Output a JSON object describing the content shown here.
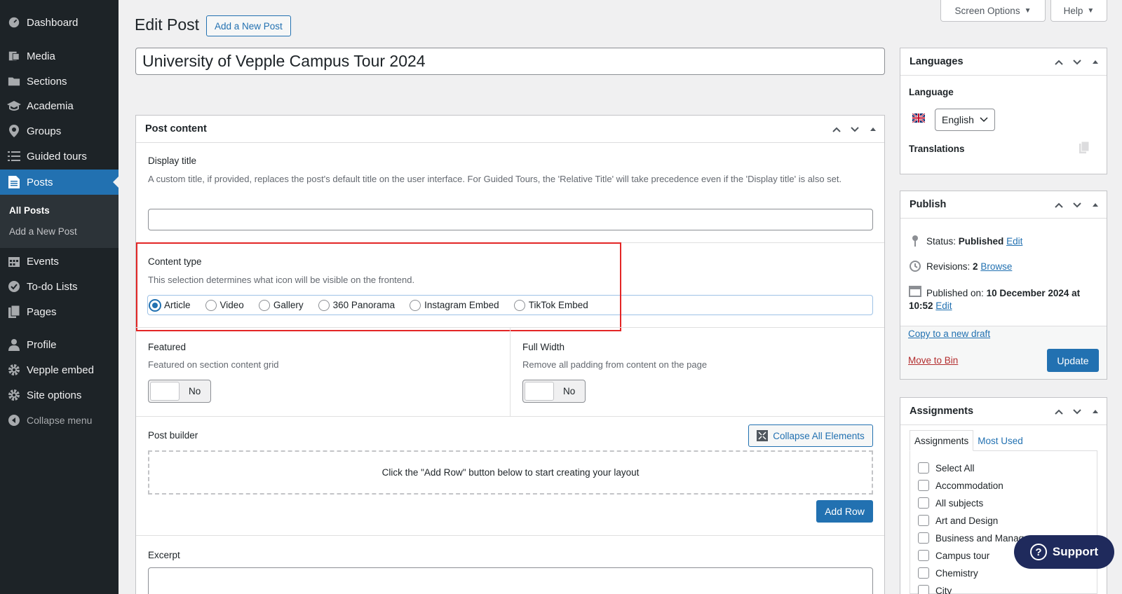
{
  "sidebar": {
    "items": [
      {
        "label": "Dashboard",
        "icon": "dashboard-icon"
      },
      {
        "label": "Media",
        "icon": "media-icon"
      },
      {
        "label": "Sections",
        "icon": "folder-icon"
      },
      {
        "label": "Academia",
        "icon": "graduation-cap-icon"
      },
      {
        "label": "Groups",
        "icon": "location-pin-icon"
      },
      {
        "label": "Guided tours",
        "icon": "list-icon"
      },
      {
        "label": "Posts",
        "icon": "posts-icon"
      },
      {
        "label": "Events",
        "icon": "calendar-icon"
      },
      {
        "label": "To-do Lists",
        "icon": "check-circle-icon"
      },
      {
        "label": "Pages",
        "icon": "pages-icon"
      },
      {
        "label": "Profile",
        "icon": "user-icon"
      },
      {
        "label": "Vepple embed",
        "icon": "gear-icon"
      },
      {
        "label": "Site options",
        "icon": "gear-icon"
      }
    ],
    "submenu": {
      "all_posts": "All Posts",
      "add_new": "Add a New Post"
    },
    "collapse": "Collapse menu"
  },
  "top_buttons": {
    "screen_options": "Screen Options",
    "help": "Help"
  },
  "header": {
    "title": "Edit Post",
    "add_new": "Add a New Post",
    "post_title": "University of Vepple Campus Tour 2024"
  },
  "post_content": {
    "heading": "Post content",
    "display_title_label": "Display title",
    "display_title_desc": "A custom title, if provided, replaces the post's default title on the user interface. For Guided Tours, the 'Relative Title' will take precedence even if the 'Display title' is also set.",
    "content_type_label": "Content type",
    "content_type_desc": "This selection determines what icon will be visible on the frontend.",
    "content_types": [
      "Article",
      "Video",
      "Gallery",
      "360 Panorama",
      "Instagram Embed",
      "TikTok Embed"
    ],
    "selected_type": "Article",
    "featured_label": "Featured",
    "featured_desc": "Featured on section content grid",
    "featured_value": "No",
    "full_width_label": "Full Width",
    "full_width_desc": "Remove all padding from content on the page",
    "full_width_value": "No",
    "post_builder_label": "Post builder",
    "collapse_all": "Collapse All Elements",
    "builder_placeholder": "Click the \"Add Row\" button below to start creating your layout",
    "add_row": "Add Row",
    "excerpt_label": "Excerpt"
  },
  "languages": {
    "heading": "Languages",
    "language_label": "Language",
    "language_value": "English",
    "translations_label": "Translations"
  },
  "publish": {
    "heading": "Publish",
    "status_label": "Status:",
    "status_value": "Published",
    "edit": "Edit",
    "revisions_label": "Revisions:",
    "revisions_value": "2",
    "browse": "Browse",
    "published_on_label": "Published on:",
    "published_on_value": "10 December 2024 at",
    "published_time": "10:52",
    "copy_draft": "Copy to a new draft",
    "move_to_bin": "Move to Bin",
    "update": "Update"
  },
  "assignments": {
    "heading": "Assignments",
    "tabs": [
      "Assignments",
      "Most Used"
    ],
    "items": [
      "Select All",
      "Accommodation",
      "All subjects",
      "Art and Design",
      "Business and Management",
      "Campus tour",
      "Chemistry",
      "City"
    ]
  },
  "support": {
    "label": "Support"
  },
  "colors": {
    "accent": "#2271b1",
    "sidebar": "#1d2327",
    "highlight": "#e32626"
  }
}
